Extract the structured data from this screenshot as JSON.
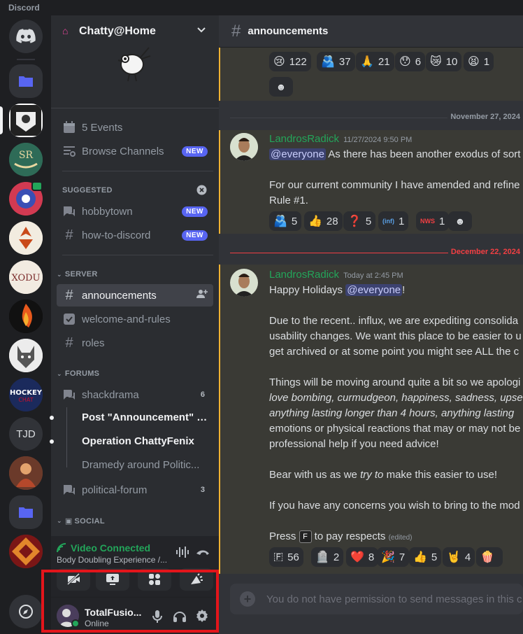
{
  "app": {
    "title": "Discord"
  },
  "server_rail": {
    "servers": [
      {
        "name": "home-icon"
      },
      {
        "name": "folder-icon"
      },
      {
        "initials": "TJD"
      }
    ]
  },
  "channel_sidebar": {
    "server_name": "Chatty@Home",
    "events_label": "5 Events",
    "browse_label": "Browse Channels",
    "new_badge": "NEW",
    "suggested": {
      "header": "SUGGESTED",
      "items": [
        {
          "label": "hobbytown"
        },
        {
          "label": "how-to-discord"
        }
      ]
    },
    "server_category": {
      "header": "SERVER",
      "items": [
        {
          "label": "announcements"
        },
        {
          "label": "welcome-and-rules"
        },
        {
          "label": "roles"
        }
      ]
    },
    "forums_category": {
      "header": "FORUMS",
      "shackdrama": {
        "label": "shackdrama",
        "count": "6"
      },
      "threads": [
        {
          "label": "Post \"Announcement\" S..."
        },
        {
          "label": "Operation ChattyFenix"
        },
        {
          "label": "Dramedy around Politic..."
        }
      ],
      "political": {
        "label": "political-forum",
        "count": "3"
      }
    },
    "social_category": {
      "header": "SOCIAL"
    }
  },
  "voice": {
    "status": "Video Connected",
    "channel": "Body Doubling Experience /..."
  },
  "user_panel": {
    "name": "TotalFusio...",
    "status": "Online"
  },
  "main": {
    "channel_name": "announcements",
    "top_reactions": [
      {
        "emoji": "😢",
        "count": "122"
      },
      {
        "emoji": "🫂",
        "count": "37"
      },
      {
        "emoji": "🙏",
        "count": "21"
      },
      {
        "emoji": "😯",
        "count": "6"
      },
      {
        "emoji": "😿",
        "count": "10"
      },
      {
        "emoji": "😫",
        "count": "1"
      }
    ],
    "divider1": "November 27, 2024",
    "msg1": {
      "author": "LandrosRadick",
      "time": "11/27/2024 9:50 PM",
      "mention": "@everyone",
      "line1": " As there has been another exodus of sort",
      "line2": "For our current community I have amended and refine",
      "line3": "Rule #1.",
      "reactions": [
        {
          "emoji": "🫂",
          "count": "5"
        },
        {
          "emoji": "👍",
          "count": "28"
        },
        {
          "emoji": "❓",
          "count": "5"
        },
        {
          "emoji": "(inf)",
          "count": "1"
        },
        {
          "emoji": "NWS",
          "count": "1"
        }
      ]
    },
    "divider2": "December 22, 2024",
    "msg2": {
      "author": "LandrosRadick",
      "time": "Today at 2:45 PM",
      "greeting": "Happy Holidays ",
      "mention": "@everyone",
      "excl": "!",
      "p1": [
        "Due to the recent.. influx, we are expediting consolida",
        "usability changes. We want this place to be easier to u",
        "get archived or at some point you might see ALL the c"
      ],
      "p2": [
        "Things will be moving around quite a bit so we apologi",
        "love bombing, curmudgeon, happiness, sadness, upset",
        "anything lasting longer than 4 hours, anything lasting",
        "emotions or physical reactions that may or may not be",
        "professional help if you need advice!"
      ],
      "p3a": "Bear with us as we ",
      "p3b": "try to",
      "p3c": " make this easier to use!",
      "p4": "If you have any concerns you wish to bring to the mod",
      "p5a": "Press ",
      "p5b": " to pay respects",
      "edited": "(edited)",
      "reactions": [
        {
          "emoji": "🇫",
          "count": "56"
        },
        {
          "emoji": "🪦",
          "count": "2"
        },
        {
          "emoji": "❤️",
          "count": "8"
        },
        {
          "emoji": "🎉",
          "count": "7"
        },
        {
          "emoji": "👍",
          "count": "5"
        },
        {
          "emoji": "🤘",
          "count": "4"
        },
        {
          "emoji": "🍿",
          "count": ""
        }
      ]
    },
    "input_placeholder": "You do not have permission to send messages in this c"
  },
  "colors": {
    "accent": "#5865f2",
    "online": "#23a55a",
    "highlight": "#f0b232",
    "red_box": "#e3151b"
  }
}
